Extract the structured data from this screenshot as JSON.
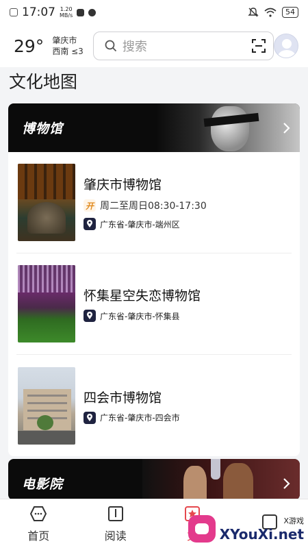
{
  "status_bar": {
    "time": "17:07",
    "net_speed_value": "1.20",
    "net_speed_unit": "MB/s",
    "battery": "54"
  },
  "header": {
    "temperature": "29°",
    "city": "肇庆市",
    "wind": "西南 ≤3",
    "search_placeholder": "搜索"
  },
  "page": {
    "title": "文化地图"
  },
  "sections": [
    {
      "banner_title": "博物馆",
      "items": [
        {
          "name": "肇庆市博物馆",
          "hours": "周二至周日08:30-17:30",
          "open_badge": "开",
          "address": "广东省-肇庆市-端州区"
        },
        {
          "name": "怀集星空失恋博物馆",
          "address": "广东省-肇庆市-怀集县"
        },
        {
          "name": "四会市博物馆",
          "address": "广东省-肇庆市-四会市"
        }
      ]
    },
    {
      "banner_title": "电影院"
    }
  ],
  "tabbar": {
    "items": [
      {
        "label": "首页",
        "icon": "home-icon"
      },
      {
        "label": "阅读",
        "icon": "book-icon"
      },
      {
        "label": "文",
        "icon": "culture-icon"
      },
      {
        "label": "",
        "icon": "profile-icon"
      }
    ]
  },
  "watermark": {
    "small": "X游戏",
    "big": "XYouXi.net"
  },
  "colors": {
    "accent": "#e5484d",
    "banner_bg": "#0b0b0b",
    "location_icon_bg": "#1f2340"
  }
}
